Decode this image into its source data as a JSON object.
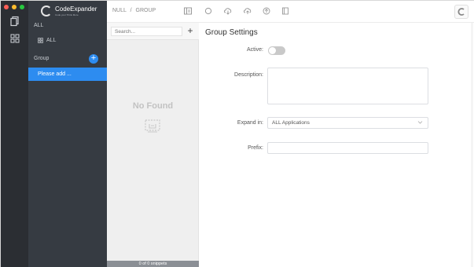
{
  "colors": {
    "accent": "#2d8cf0",
    "activity_bg": "#2b2e33",
    "sidebar_bg": "#363b42",
    "traffic_red": "#ff5f57",
    "traffic_yellow": "#febc2e",
    "traffic_green": "#28c840"
  },
  "activity_bar": {
    "icons": [
      "documents-icon",
      "grid-icon"
    ]
  },
  "sidebar": {
    "logo": {
      "name": "CodeExpander",
      "tagline": "Code your Think More"
    },
    "all_header": "ALL",
    "all_item": {
      "label": "ALL",
      "icon": "grid-icon"
    },
    "group_header": "Group",
    "selected_group": "Please add ..."
  },
  "topbar": {
    "breadcrumb": [
      "NULL",
      "GROUP"
    ],
    "breadcrumb_separator": "/",
    "icons": [
      "panel-icon",
      "circle-icon",
      "cloud-download-icon",
      "cloud-upload-icon",
      "arrow-up-circle-icon",
      "book-icon",
      "logo-icon"
    ]
  },
  "snippets": {
    "search_placeholder": "Search...",
    "add_label": "+",
    "empty_text": "No Found",
    "count_text": "0 of 0 snippets"
  },
  "settings": {
    "title": "Group Settings",
    "active_label": "Active:",
    "active_value": false,
    "description_label": "Description:",
    "description_value": "",
    "expand_label": "Expand in:",
    "expand_value": "ALL Applications",
    "prefix_label": "Prefix:",
    "prefix_value": ""
  }
}
